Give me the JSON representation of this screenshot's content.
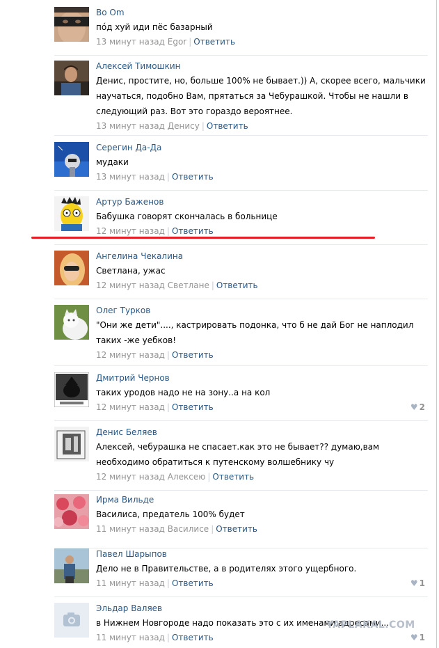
{
  "comments": [
    {
      "author": "Bo Om",
      "text": "пóд хуй иди пёс базарный",
      "time": "13 минут назад",
      "reply_to": "Egor",
      "reply": "Ответить",
      "likes": null,
      "avatar": "masked-face"
    },
    {
      "author": "Алексей Тимошкин",
      "text": "Денис, простите, но, больше 100% не бывает.)) А, скорее всего, мальчики научаться, подобно Вам, прятаться за Чебурашкой. Чтобы не нашли в следующий раз. Вот это гораздо вероятнее.",
      "time": "13 минут назад",
      "reply_to": "Денису",
      "reply": "Ответить",
      "likes": null,
      "avatar": "man-dark"
    },
    {
      "author": "Серегин Да-Да",
      "text": "мудаки",
      "time": "13 минут назад",
      "reply_to": "",
      "reply": "Ответить",
      "likes": null,
      "avatar": "space-figure"
    },
    {
      "author": "Артур Баженов",
      "text": "Бабушка говорят скончалась в больнице",
      "time": "12 минут назад",
      "reply_to": "",
      "reply": "Ответить",
      "likes": null,
      "avatar": "cartoon-face"
    },
    {
      "author": "Ангелина Чекалина",
      "text": "Светлана, ужас",
      "time": "12 минут назад",
      "reply_to": "Светлане",
      "reply": "Ответить",
      "likes": null,
      "avatar": "woman-sunglasses"
    },
    {
      "author": "Олег Турков",
      "text": "\"Они же дети\"...., кастрировать подонка, что б не дай Бог не наплодил таких -же уебков!",
      "time": "12 минут назад",
      "reply_to": "",
      "reply": "Ответить",
      "likes": null,
      "avatar": "white-cat"
    },
    {
      "author": "Дмитрий Чернов",
      "text": "таких уродов надо не на зону..а на кол",
      "time": "12 минут назад",
      "reply_to": "",
      "reply": "Ответить",
      "likes": "2",
      "avatar": "dark-silhouette"
    },
    {
      "author": "Денис Беляев",
      "text": "Алексей, чебурашка не спасает.как это не бывает?? думаю,вам необходимо обратиться к путенскому волшебнику чу",
      "time": "12 минут назад",
      "reply_to": "Алексею",
      "reply": "Ответить",
      "likes": null,
      "avatar": "cube-logo"
    },
    {
      "author": "Ирма Вильде",
      "text": "Василиса, предатель 100% будет",
      "time": "11 минут назад",
      "reply_to": "Василисе",
      "reply": "Ответить",
      "likes": null,
      "avatar": "roses"
    },
    {
      "author": "Павел Шарыпов",
      "text": "Дело не в Правительстве, а в родителях этого ущербного.",
      "time": "11 минут назад",
      "reply_to": "",
      "reply": "Ответить",
      "likes": "1",
      "avatar": "man-seaside"
    },
    {
      "author": "Эльдар Валяев",
      "text": "в Нижнем Новгороде надо показать это с их именами,адресами...",
      "time": "11 минут назад",
      "reply_to": "",
      "reply": "Ответить",
      "likes": "1",
      "avatar": "camera-placeholder"
    }
  ],
  "watermark": "YAPLAKAL.COM"
}
